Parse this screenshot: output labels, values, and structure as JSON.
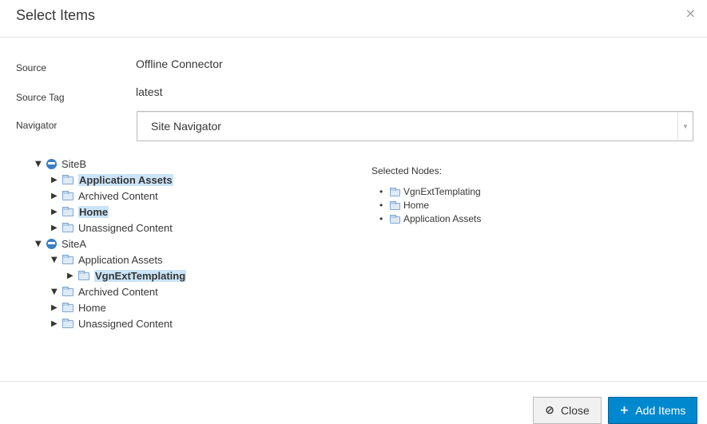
{
  "dialog": {
    "title": "Select Items",
    "close_glyph": "×"
  },
  "form": {
    "source_label": "Source",
    "source_value": "Offline Connector",
    "source_tag_label": "Source Tag",
    "source_tag_value": "latest",
    "navigator_label": "Navigator",
    "navigator_selected": "Site Navigator"
  },
  "tree": {
    "sites": [
      {
        "label": "SiteB",
        "expanded": true,
        "children": [
          {
            "label": "Application Assets",
            "selected": true,
            "expanded": false
          },
          {
            "label": "Archived Content",
            "selected": false,
            "expanded": false
          },
          {
            "label": "Home",
            "selected": true,
            "expanded": false
          },
          {
            "label": "Unassigned Content",
            "selected": false,
            "expanded": false
          }
        ]
      },
      {
        "label": "SiteA",
        "expanded": true,
        "children": [
          {
            "label": "Application Assets",
            "selected": false,
            "expanded": true,
            "children": [
              {
                "label": "VgnExtTemplating",
                "selected": true,
                "expanded": false
              }
            ]
          },
          {
            "label": "Archived Content",
            "selected": false,
            "expanded": true
          },
          {
            "label": "Home",
            "selected": false,
            "expanded": false
          },
          {
            "label": "Unassigned Content",
            "selected": false,
            "expanded": false
          }
        ]
      }
    ]
  },
  "selected_nodes": {
    "heading": "Selected Nodes:",
    "items": [
      "VgnExtTemplating",
      "Home",
      "Application Assets"
    ]
  },
  "footer": {
    "close_label": "Close",
    "add_label": "Add Items"
  },
  "icons": {
    "site": "globe-icon",
    "node": "folder-icon",
    "expanded": "triangle-down-icon",
    "collapsed": "triangle-right-icon",
    "close": "ban-icon",
    "add": "plus-icon"
  },
  "colors": {
    "primary": "#0088ce",
    "selection_highlight": "#cbe4f7"
  }
}
